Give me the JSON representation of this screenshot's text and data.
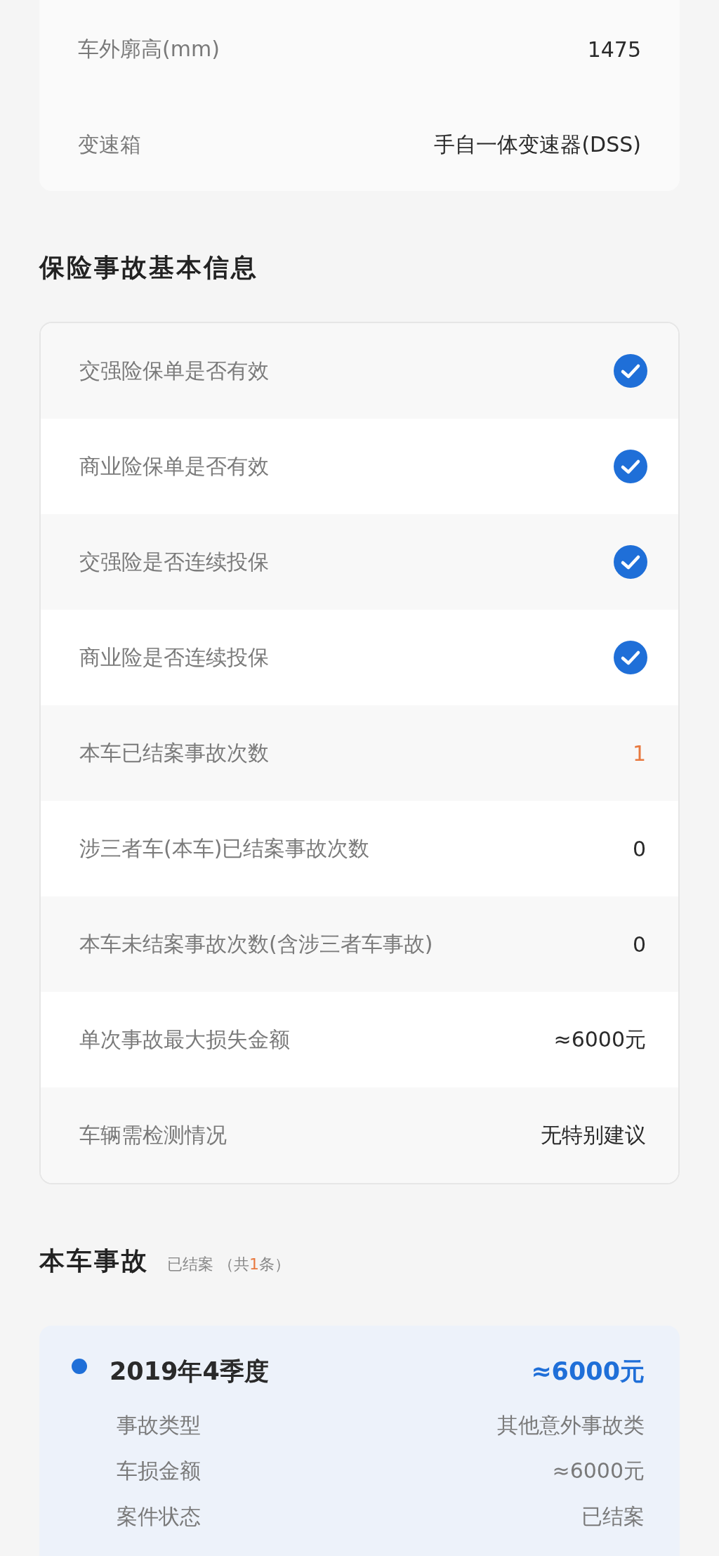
{
  "vehicle_specs": [
    {
      "label": "车外廓高(mm)",
      "value": "1475"
    },
    {
      "label": "变速箱",
      "value": "手自一体变速器(DSS)"
    }
  ],
  "insurance_section": {
    "title": "保险事故基本信息",
    "rows": [
      {
        "kind": "check",
        "label": "交强险保单是否有效",
        "checked": true
      },
      {
        "kind": "check",
        "label": "商业险保单是否有效",
        "checked": true
      },
      {
        "kind": "check",
        "label": "交强险是否连续投保",
        "checked": true
      },
      {
        "kind": "check",
        "label": "商业险是否连续投保",
        "checked": true
      },
      {
        "kind": "text",
        "label": "本车已结案事故次数",
        "value": "1",
        "highlight": true
      },
      {
        "kind": "text",
        "label": "涉三者车(本车)已结案事故次数",
        "value": "0",
        "highlight": false
      },
      {
        "kind": "text",
        "label": "本车未结案事故次数(含涉三者车事故)",
        "value": "0",
        "highlight": false
      },
      {
        "kind": "text",
        "label": "单次事故最大损失金额",
        "value": "≈6000元",
        "highlight": false
      },
      {
        "kind": "text",
        "label": "车辆需检测情况",
        "value": "无特别建议",
        "highlight": false
      }
    ]
  },
  "accident_section": {
    "title": "本车事故",
    "status": "已结案",
    "count_before": "（共",
    "count": "1",
    "count_after": "条）",
    "records": [
      {
        "period": "2019年4季度",
        "amount": "≈6000元",
        "details": [
          {
            "label": "事故类型",
            "value": "其他意外事故类"
          },
          {
            "label": "车损金额",
            "value": "≈6000元"
          },
          {
            "label": "案件状态",
            "value": "已结案"
          }
        ]
      }
    ]
  }
}
